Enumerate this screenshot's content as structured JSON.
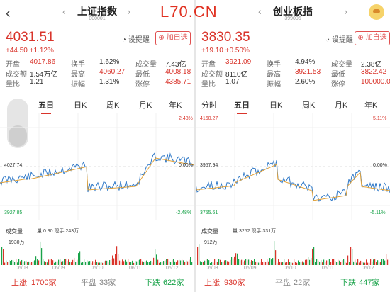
{
  "watermark": "L70.CN",
  "left": {
    "title": "上证指数",
    "code": "000001",
    "price": "4031.51",
    "change": "+44.50",
    "change_pct": "+1.12%",
    "alert_label": "设提醒",
    "add_label": "加自选",
    "stats": [
      {
        "label": "开盘",
        "value": "4017.86",
        "label2": "换手",
        "value2": "1.62%",
        "label3": "成交量",
        "value3": "7.43亿"
      },
      {
        "label": "成交额",
        "value": "1.54万亿",
        "label2": "最高",
        "value2": "4060.27",
        "label3": "最低",
        "value3": "4008.18"
      },
      {
        "label": "量比",
        "value": "1.21",
        "label2": "振幅",
        "value2": "1.31%",
        "label3": "涨停",
        "value3": "4385.71"
      }
    ],
    "tabs": [
      "分时",
      "五日",
      "日K",
      "周K",
      "月K",
      "年K"
    ],
    "active_tab": "五日",
    "axis": {
      "top_pct": "2.48%",
      "mid": "4027.74",
      "bottom": "3927.85",
      "bottom_pct": "-2.48%",
      "mid_pct": "0.00%"
    },
    "vol_title": "成交量",
    "vol_info": "量:0.90  现手:243万",
    "vol_max": "1930万",
    "dates": [
      "06/08",
      "06/09",
      "06/10",
      "06/11",
      "06/12"
    ],
    "up_label": "上涨",
    "up_count": "1700家",
    "flat_label": "平盘",
    "flat_count": "33家",
    "down_label": "下跌",
    "down_count": "622家",
    "colors": {
      "up": "#d9342b",
      "down": "#1aa34a",
      "line": "#2e78c7",
      "avg": "#e3a33a"
    }
  },
  "right": {
    "title": "创业板指",
    "code": "399006",
    "price": "3830.35",
    "change": "+19.10",
    "change_pct": "+0.50%",
    "alert_label": "设提醒",
    "add_label": "加自选",
    "stats": [
      {
        "label": "开盘",
        "value": "3921.09",
        "label2": "换手",
        "value2": "4.94%",
        "label3": "成交量",
        "value3": "2.38亿"
      },
      {
        "label": "成交额",
        "value": "8110亿",
        "label2": "最高",
        "value2": "3921.53",
        "label3": "最低",
        "value3": "3822.42"
      },
      {
        "label": "量比",
        "value": "1.07",
        "label2": "振幅",
        "value2": "2.60%",
        "label3": "涨停",
        "value3": "100000.0"
      }
    ],
    "tabs": [
      "分时",
      "五日",
      "日K",
      "周K",
      "月K",
      "年K"
    ],
    "active_tab": "五日",
    "axis": {
      "top": "4160.27",
      "top_pct": "5.11%",
      "mid": "3957.94",
      "mid_pct": "0.00%",
      "bottom": "3755.61",
      "bottom_pct": "-5.11%"
    },
    "vol_title": "成交量",
    "vol_info": "量:3252  现手:331万",
    "vol_max": "912万",
    "dates": [
      "06/08",
      "06/09",
      "06/10",
      "06/11",
      "06/12"
    ],
    "up_label": "上涨",
    "up_count": "930家",
    "flat_label": "平盘",
    "flat_count": "22家",
    "down_label": "下跌",
    "down_count": "447家"
  }
}
